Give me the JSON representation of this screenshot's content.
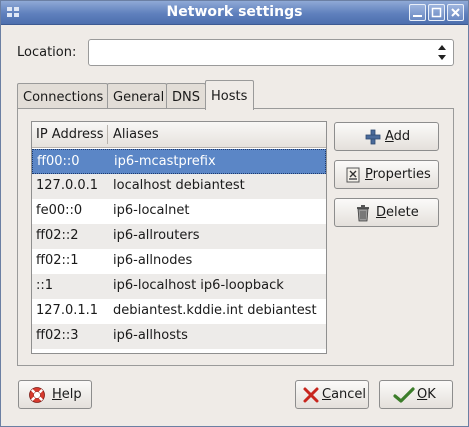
{
  "window": {
    "title": "Network settings"
  },
  "location": {
    "label": "Location:",
    "value": ""
  },
  "tabs": [
    {
      "label": "Connections"
    },
    {
      "label": "General"
    },
    {
      "label": "DNS"
    },
    {
      "label": "Hosts"
    }
  ],
  "active_tab": "Hosts",
  "hosts_table": {
    "columns": [
      "IP Address",
      "Aliases"
    ],
    "rows": [
      {
        "ip": "ff00::0",
        "aliases": "ip6-mcastprefix"
      },
      {
        "ip": "127.0.0.1",
        "aliases": "localhost debiantest"
      },
      {
        "ip": "fe00::0",
        "aliases": "ip6-localnet"
      },
      {
        "ip": "ff02::2",
        "aliases": "ip6-allrouters"
      },
      {
        "ip": "ff02::1",
        "aliases": "ip6-allnodes"
      },
      {
        "ip": "::1",
        "aliases": "ip6-localhost ip6-loopback"
      },
      {
        "ip": "127.0.1.1",
        "aliases": "debiantest.kddie.int debiantest"
      },
      {
        "ip": "ff02::3",
        "aliases": "ip6-allhosts"
      }
    ],
    "selected_index": 0
  },
  "side_buttons": {
    "add": "Add",
    "properties": "Properties",
    "delete": "Delete"
  },
  "footer": {
    "help": "Help",
    "cancel": "Cancel",
    "ok": "OK"
  },
  "icons": {
    "window_menu": "window-menu-icon",
    "minimize": "minimize-icon",
    "maximize": "maximize-icon",
    "close": "close-icon",
    "add": "plus-icon",
    "properties": "properties-icon",
    "delete": "trash-icon",
    "help": "lifebuoy-icon",
    "cancel": "x-icon",
    "ok": "checkmark-icon"
  },
  "colors": {
    "titlebar": "#5f80bd",
    "selection": "#5b86c6",
    "window_bg": "#efebe7"
  }
}
